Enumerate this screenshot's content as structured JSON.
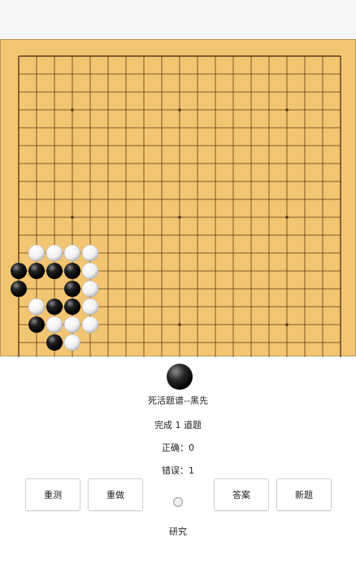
{
  "board": {
    "size": 19,
    "stones": [
      {
        "c": 1,
        "r": 11,
        "color": "white"
      },
      {
        "c": 2,
        "r": 11,
        "color": "white"
      },
      {
        "c": 3,
        "r": 11,
        "color": "white"
      },
      {
        "c": 4,
        "r": 11,
        "color": "white"
      },
      {
        "c": 0,
        "r": 12,
        "color": "black"
      },
      {
        "c": 1,
        "r": 12,
        "color": "black"
      },
      {
        "c": 2,
        "r": 12,
        "color": "black"
      },
      {
        "c": 3,
        "r": 12,
        "color": "black"
      },
      {
        "c": 4,
        "r": 12,
        "color": "white"
      },
      {
        "c": 0,
        "r": 13,
        "color": "black"
      },
      {
        "c": 3,
        "r": 13,
        "color": "black"
      },
      {
        "c": 4,
        "r": 13,
        "color": "white"
      },
      {
        "c": 1,
        "r": 14,
        "color": "white"
      },
      {
        "c": 2,
        "r": 14,
        "color": "black"
      },
      {
        "c": 3,
        "r": 14,
        "color": "black"
      },
      {
        "c": 4,
        "r": 14,
        "color": "white"
      },
      {
        "c": 1,
        "r": 15,
        "color": "black"
      },
      {
        "c": 2,
        "r": 15,
        "color": "white"
      },
      {
        "c": 3,
        "r": 15,
        "color": "white"
      },
      {
        "c": 4,
        "r": 15,
        "color": "white"
      },
      {
        "c": 2,
        "r": 16,
        "color": "black"
      },
      {
        "c": 3,
        "r": 16,
        "color": "white"
      }
    ],
    "star_points": [
      [
        3,
        3
      ],
      [
        9,
        3
      ],
      [
        15,
        3
      ],
      [
        3,
        9
      ],
      [
        9,
        9
      ],
      [
        15,
        9
      ],
      [
        3,
        15
      ],
      [
        9,
        15
      ],
      [
        15,
        15
      ]
    ]
  },
  "turn_stone": "black",
  "title": "死活题谱--黑先",
  "completed": "完成 1 道题",
  "correct": "正确：0",
  "wrong": "错误：1",
  "buttons": {
    "retest": "重测",
    "redo": "重做",
    "answer": "答案",
    "new_problem": "新题"
  },
  "research": "研究"
}
